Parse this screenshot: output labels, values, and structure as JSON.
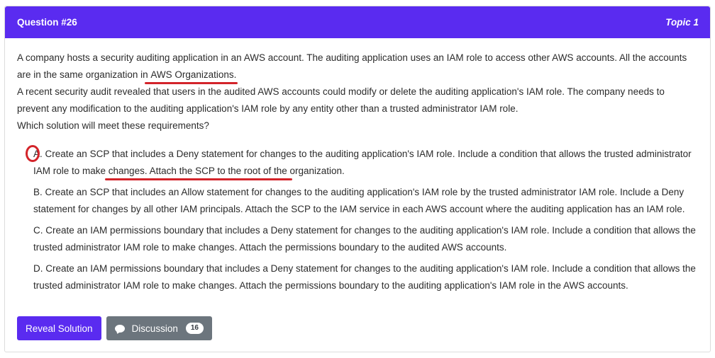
{
  "header": {
    "question_label": "Question #26",
    "topic_label": "Topic 1"
  },
  "question": {
    "line1_before": "A company hosts a security auditing application in an AWS account. The auditing application uses an IAM role to access other AWS accounts. All the accounts are in the same organization in ",
    "line1_highlight": "AWS Organizations.",
    "line2": "A recent security audit revealed that users in the audited AWS accounts could modify or delete the auditing application's IAM role. The company needs to prevent any modification to the auditing application's IAM role by any entity other than a trusted administrator IAM role.",
    "line3": "Which solution will meet these requirements?"
  },
  "choices": [
    {
      "letter": "A.",
      "text_before": "Create an SCP that includes a Deny statement for changes to the auditing application's IAM role. Include a condition that allows the trusted administrator IAM role to make changes. ",
      "text_highlight": "Attach the SCP to the root of the organization."
    },
    {
      "letter": "B.",
      "text": "Create an SCP that includes an Allow statement for changes to the auditing application's IAM role by the trusted administrator IAM role. Include a Deny statement for changes by all other IAM principals. Attach the SCP to the IAM service in each AWS account where the auditing application has an IAM role."
    },
    {
      "letter": "C.",
      "text": "Create an IAM permissions boundary that includes a Deny statement for changes to the auditing application's IAM role. Include a condition that allows the trusted administrator IAM role to make changes. Attach the permissions boundary to the audited AWS accounts."
    },
    {
      "letter": "D.",
      "text": "Create an IAM permissions boundary that includes a Deny statement for changes to the auditing application's IAM role. Include a condition that allows the trusted administrator IAM role to make changes. Attach the permissions boundary to the auditing application's IAM role in the AWS accounts."
    }
  ],
  "buttons": {
    "reveal_label": "Reveal Solution",
    "discussion_label": "Discussion",
    "discussion_count": "16"
  },
  "colors": {
    "header_bg": "#5a2bf0",
    "annotation_red": "#d3242a",
    "secondary_button": "#6c757d"
  }
}
